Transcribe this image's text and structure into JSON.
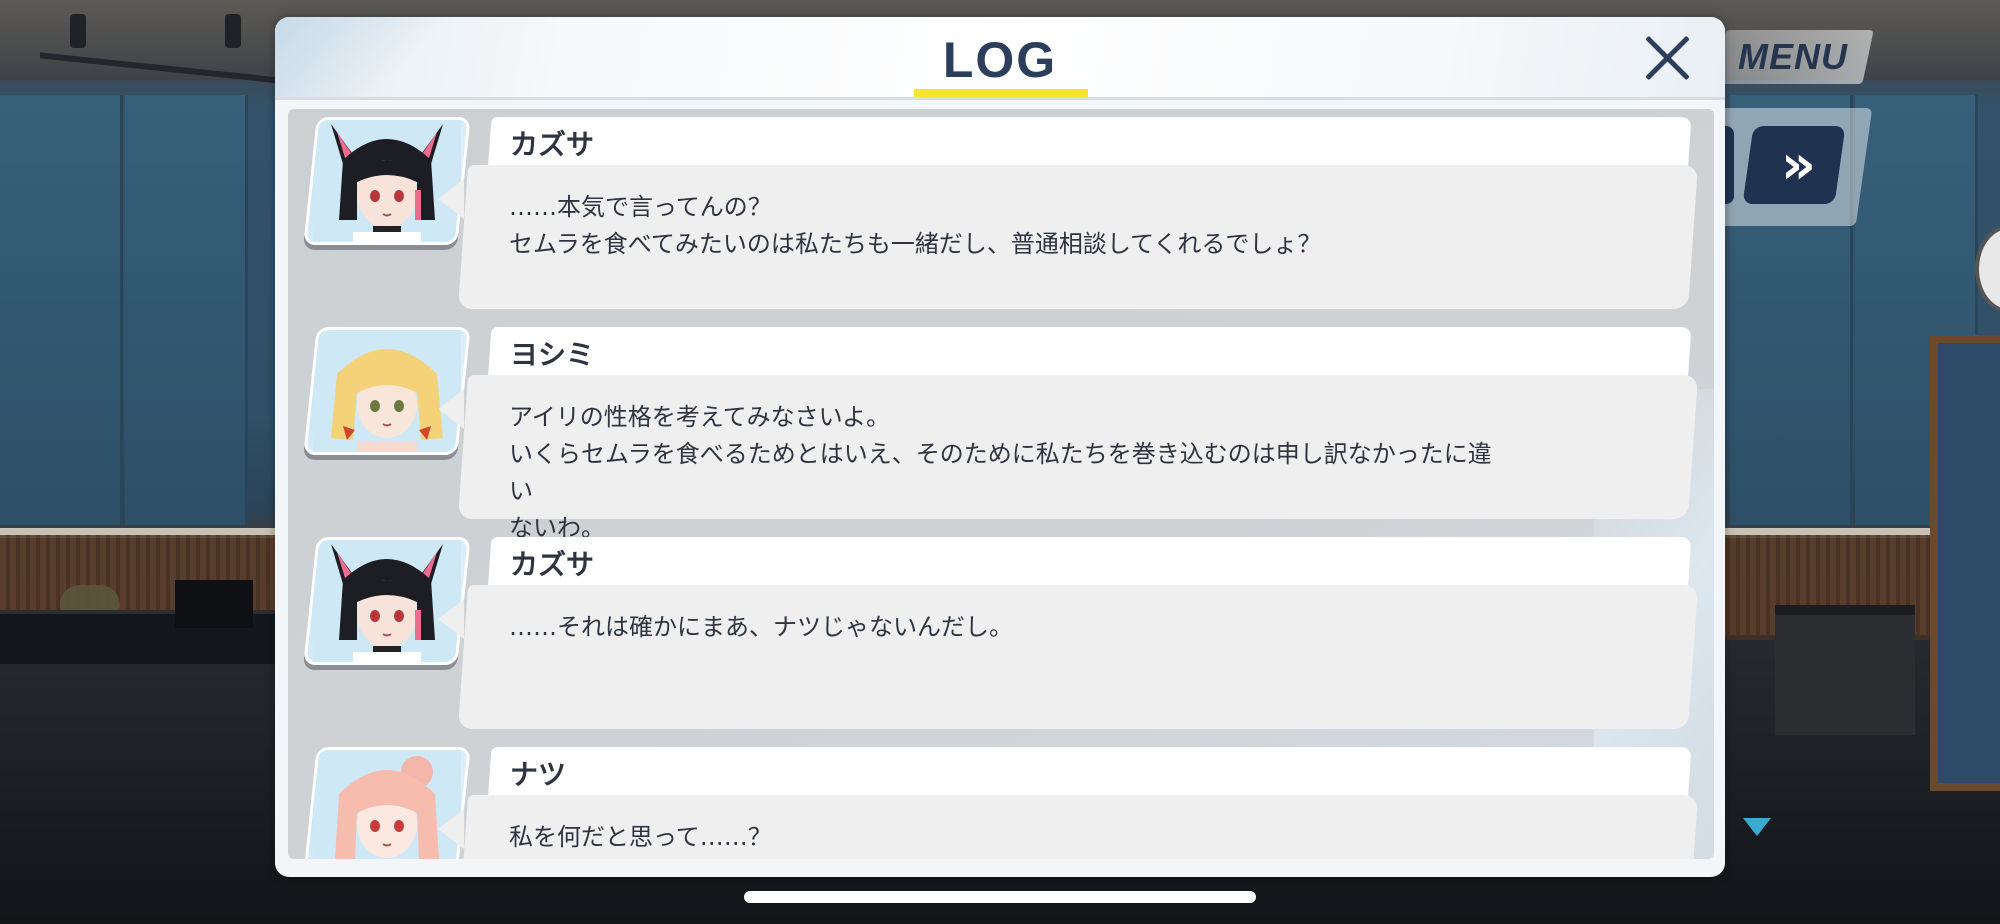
{
  "hud": {
    "menu_label": "MENU",
    "fast_forward_glyph": "»",
    "scroll_indicator_icon": "triangle-down-icon"
  },
  "modal": {
    "title": "LOG",
    "close_icon": "close-x-icon",
    "accent_color": "#f5e62a",
    "title_color": "#2b3e5c"
  },
  "log": {
    "entries": [
      {
        "speaker": "カズサ",
        "avatar": "kazusa-portrait",
        "text": "……本気で言ってんの？\nセムラを食べてみたいのは私たちも一緒だし、普通相談してくれるでしょ？"
      },
      {
        "speaker": "ヨシミ",
        "avatar": "yoshimi-portrait",
        "text": "アイリの性格を考えてみなさいよ。\nいくらセムラを食べるためとはいえ、そのために私たちを巻き込むのは申し訳なかったに違い\nないわ。"
      },
      {
        "speaker": "カズサ",
        "avatar": "kazusa-portrait",
        "text": "……それは確かにまあ、ナツじゃないんだし。"
      },
      {
        "speaker": "ナツ",
        "avatar": "natsu-portrait",
        "text": "私を何だと思って……？"
      }
    ]
  }
}
